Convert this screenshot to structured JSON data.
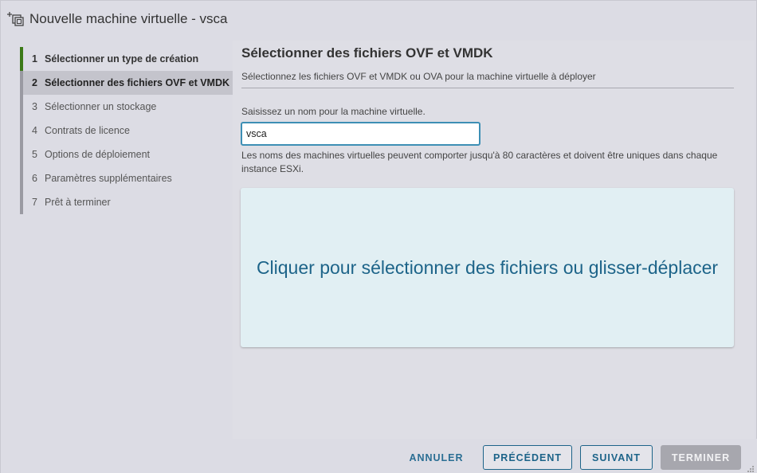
{
  "window": {
    "title": "Nouvelle machine virtuelle - vsca",
    "icon": "add-vm-icon"
  },
  "steps": [
    {
      "num": "1",
      "label": "Sélectionner un type de création",
      "state": "done"
    },
    {
      "num": "2",
      "label": "Sélectionner des fichiers OVF et VMDK",
      "state": "active"
    },
    {
      "num": "3",
      "label": "Sélectionner un stockage",
      "state": "pending"
    },
    {
      "num": "4",
      "label": "Contrats de licence",
      "state": "pending"
    },
    {
      "num": "5",
      "label": "Options de déploiement",
      "state": "pending"
    },
    {
      "num": "6",
      "label": "Paramètres supplémentaires",
      "state": "pending"
    },
    {
      "num": "7",
      "label": "Prêt à terminer",
      "state": "pending"
    }
  ],
  "main": {
    "title": "Sélectionner des fichiers OVF et VMDK",
    "subtitle": "Sélectionnez les fichiers OVF et VMDK ou OVA pour la machine virtuelle à déployer",
    "name_label": "Saisissez un nom pour la machine virtuelle.",
    "name_value": "vsca",
    "help_text": "Les noms des machines virtuelles peuvent comporter jusqu'à 80 caractères et doivent être uniques dans chaque instance ESXi.",
    "dropzone_text": "Cliquer pour sélectionner des fichiers ou glisser-déplacer"
  },
  "footer": {
    "cancel": "ANNULER",
    "previous": "PRÉCÉDENT",
    "next": "SUIVANT",
    "finish": "TERMINER"
  },
  "colors": {
    "accent": "#1d6489",
    "step_done": "#3c7a18",
    "dropzone_bg": "#e1eff3",
    "input_focus": "#3d8fb5"
  }
}
